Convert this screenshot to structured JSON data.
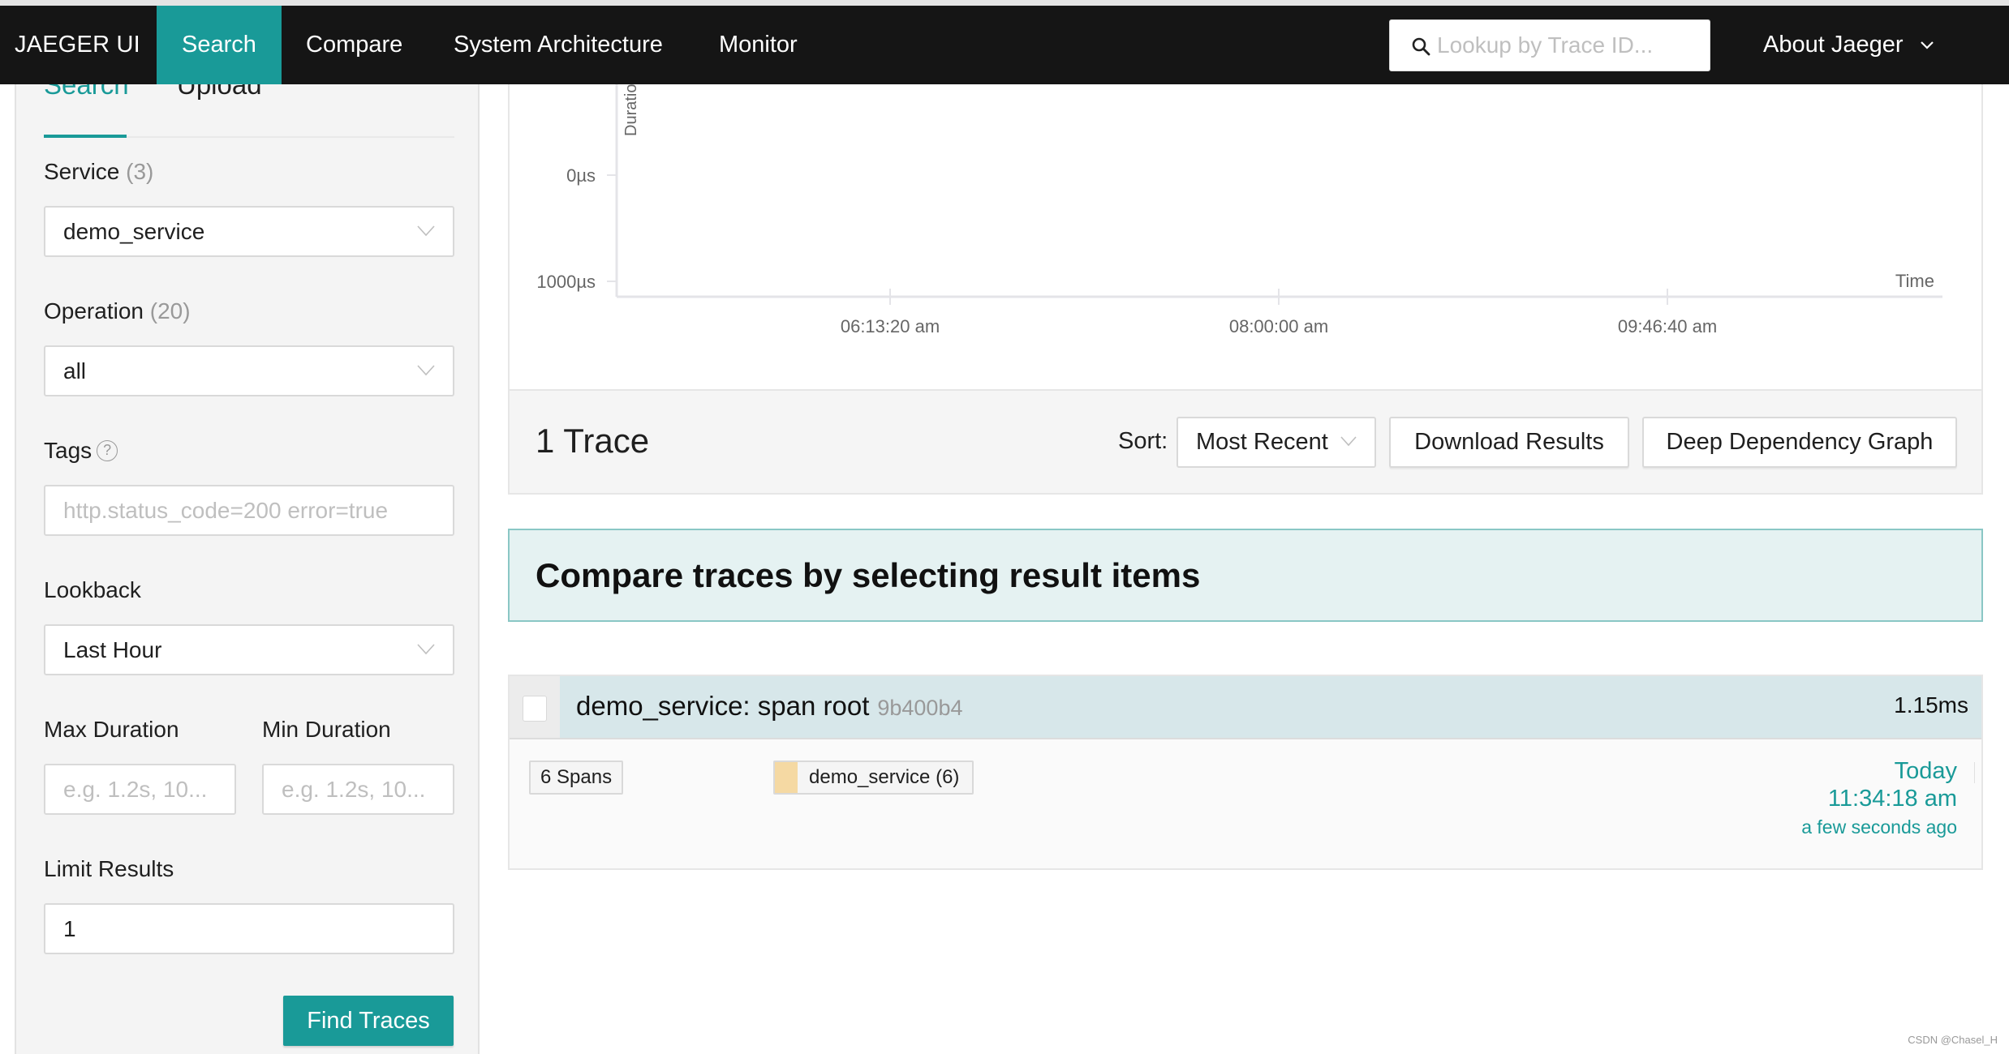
{
  "navbar": {
    "brand": "JAEGER UI",
    "items": [
      {
        "label": "Search",
        "active": true
      },
      {
        "label": "Compare",
        "active": false
      },
      {
        "label": "System Architecture",
        "active": false
      },
      {
        "label": "Monitor",
        "active": false
      }
    ],
    "lookup_placeholder": "Lookup by Trace ID...",
    "about_label": "About Jaeger"
  },
  "sidebar": {
    "tabs": [
      {
        "label": "Search",
        "active": true
      },
      {
        "label": "Upload",
        "active": false
      }
    ],
    "service": {
      "label": "Service",
      "count": "(3)",
      "value": "demo_service"
    },
    "operation": {
      "label": "Operation",
      "count": "(20)",
      "value": "all"
    },
    "tags": {
      "label": "Tags",
      "help": "?",
      "placeholder": "http.status_code=200 error=true"
    },
    "lookback": {
      "label": "Lookback",
      "value": "Last Hour"
    },
    "max_duration": {
      "label": "Max Duration",
      "placeholder": "e.g. 1.2s, 10..."
    },
    "min_duration": {
      "label": "Min Duration",
      "placeholder": "e.g. 1.2s, 10..."
    },
    "limit": {
      "label": "Limit Results",
      "value": "1"
    },
    "find_button": "Find Traces"
  },
  "chart_data": {
    "type": "scatter",
    "title": "",
    "ylabel": "Duration",
    "xlabel": "Time",
    "y_ticks": [
      "0µs",
      "1000µs"
    ],
    "x_ticks": [
      "06:13:20 am",
      "08:00:00 am",
      "09:46:40 am"
    ],
    "series": [],
    "grid": false
  },
  "results": {
    "title": "1 Trace",
    "sort_label": "Sort:",
    "sort_value": "Most Recent",
    "download_button": "Download Results",
    "ddg_button": "Deep Dependency Graph",
    "compare_banner": "Compare traces by selecting result items"
  },
  "traces": [
    {
      "name": "demo_service: span root",
      "id": "9b400b4",
      "duration": "1.15ms",
      "spans": "6 Spans",
      "services": [
        {
          "label": "demo_service (6)",
          "color": "#f5d9a3"
        }
      ],
      "day": "Today",
      "time": "11:34:18 am",
      "ago": "a few seconds ago"
    }
  ],
  "colors": {
    "accent": "#199a98",
    "navbar": "#151515",
    "compare_bg": "#e5f2f2",
    "trace_header_bg": "#d7e7ea"
  },
  "watermark": "CSDN @Chasel_H"
}
